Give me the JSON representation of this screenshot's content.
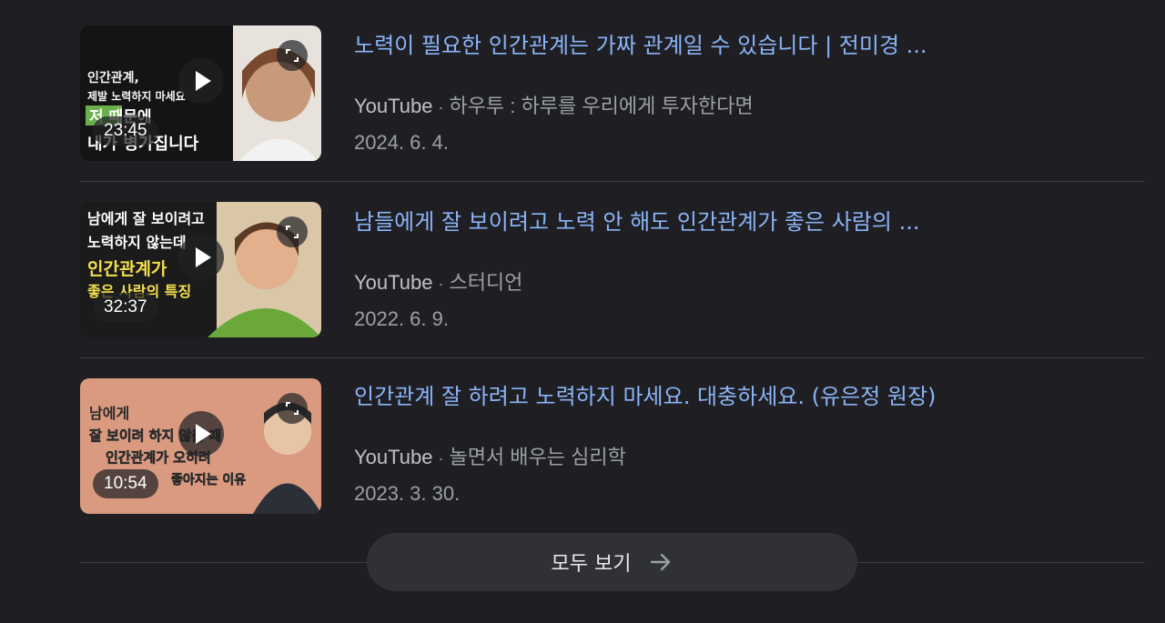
{
  "videos": [
    {
      "title": "노력이 필요한 인간관계는 가짜 관계일 수 있습니다 | 전미경 ...",
      "source": "YouTube",
      "channel": "하우투 : 하루를 우리에게 투자한다면",
      "date": "2024. 6. 4.",
      "duration": "23:45",
      "thumbnail_text": [
        "인간관계,",
        "제발 노력하지 마세요",
        "저 때문에",
        "내가 병가집니다"
      ]
    },
    {
      "title": "남들에게 잘 보이려고 노력 안 해도 인간관계가 좋은 사람의 ...",
      "source": "YouTube",
      "channel": "스터디언",
      "date": "2022. 6. 9.",
      "duration": "32:37",
      "thumbnail_text": [
        "남에게 잘 보이려고",
        "노력하지 않는데",
        "인간관계가",
        "좋은 사람의 특징"
      ]
    },
    {
      "title": "인간관계 잘 하려고 노력하지 마세요. 대충하세요. (유은정 원장)",
      "source": "YouTube",
      "channel": "놀면서 배우는 심리학",
      "date": "2023. 3. 30.",
      "duration": "10:54",
      "thumbnail_text": [
        "남에게",
        "잘 보이려 하지 않을 때",
        "인간관계가 오히려",
        "좋아지는 이유"
      ]
    }
  ],
  "meta_separator": "·",
  "see_all_label": "모두 보기",
  "icons": {
    "play": "play-icon",
    "expand": "expand-icon",
    "arrow": "arrow-right-icon"
  },
  "colors": {
    "background": "#1f1f23",
    "title_link": "#8ab4f8",
    "meta_text": "#9aa0a6",
    "divider": "#3c4043",
    "button_bg": "#303134"
  }
}
